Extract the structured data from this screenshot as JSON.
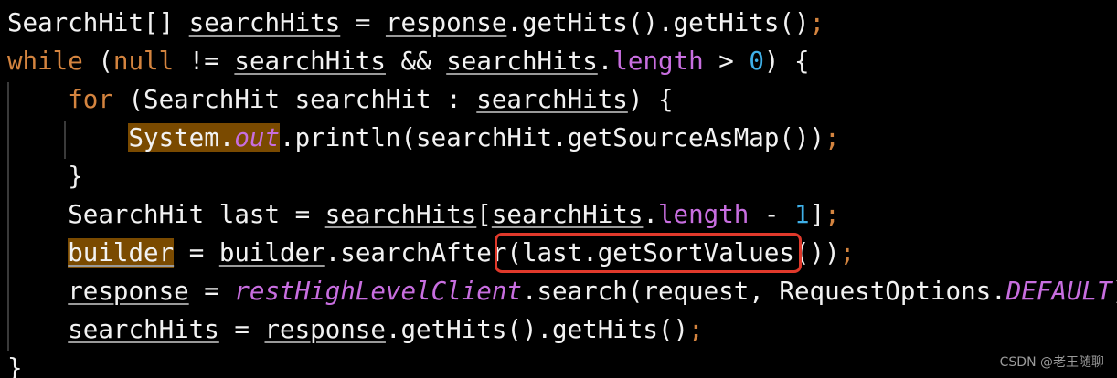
{
  "code": {
    "line1": {
      "type": "SearchHit[] ",
      "var": "searchHits",
      "eq": " = ",
      "resp": "response",
      "rest": ".getHits().getHits()",
      "semi": ";"
    },
    "line2": {
      "kw_while": "while",
      "open": " (",
      "kw_null": "null",
      "ne": " != ",
      "var1": "searchHits",
      "and": " && ",
      "var2": "searchHits",
      "dot": ".",
      "length": "length",
      "gt": " > ",
      "zero": "0",
      "close": ") {"
    },
    "line3": {
      "kw_for": "for",
      "open": " (SearchHit searchHit : ",
      "var": "searchHits",
      "close": ") {"
    },
    "line4": {
      "system": "System.",
      "out": "out",
      "rest": ".println(searchHit.getSourceAsMap())",
      "semi": ";"
    },
    "line5": {
      "brace": "}"
    },
    "line6": {
      "decl": "SearchHit last = ",
      "var1": "searchHits",
      "open": "[",
      "var2": "searchHits",
      "dot": ".",
      "length": "length",
      "minus": " - ",
      "one": "1",
      "close": "]",
      "semi": ";"
    },
    "line7": {
      "builder1": "builder",
      "eq": " = ",
      "builder2": "builder",
      "call": ".searchAfter",
      "boxed": "(last.getSortValues()",
      "close": ")",
      "semi": ";"
    },
    "line8": {
      "resp": "response",
      "eq": " = ",
      "client": "restHighLevelClient",
      "call": ".search(request, RequestOptions.",
      "default": "DEFAULT",
      "close": ")",
      "semi": ";"
    },
    "line9": {
      "var": "searchHits",
      "eq": " = ",
      "resp": "response",
      "rest": ".getHits().getHits()",
      "semi": ";"
    },
    "line10": {
      "brace": "}"
    }
  },
  "watermark": "CSDN @老王随聊",
  "colors": {
    "background": "#000000",
    "keyword": "#d4843f",
    "number": "#3fb0e8",
    "field": "#c86ee0",
    "highlight": "#7a4a00",
    "annotation_box": "#e0392b"
  }
}
